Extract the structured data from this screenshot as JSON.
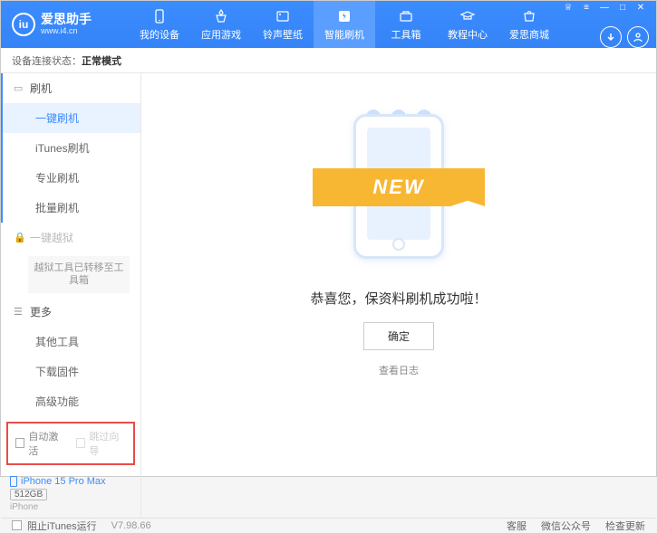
{
  "header": {
    "logo_title": "爱思助手",
    "logo_sub": "www.i4.cn",
    "nav": [
      {
        "label": "我的设备"
      },
      {
        "label": "应用游戏"
      },
      {
        "label": "铃声壁纸"
      },
      {
        "label": "智能刷机"
      },
      {
        "label": "工具箱"
      },
      {
        "label": "教程中心"
      },
      {
        "label": "爱思商城"
      }
    ]
  },
  "status": {
    "prefix": "设备连接状态：",
    "value": "正常模式"
  },
  "sidebar": {
    "group_flash": "刷机",
    "items_flash": [
      "一键刷机",
      "iTunes刷机",
      "专业刷机",
      "批量刷机"
    ],
    "group_jailbreak": "一键越狱",
    "jailbreak_note": "越狱工具已转移至工具箱",
    "group_more": "更多",
    "items_more": [
      "其他工具",
      "下载固件",
      "高级功能"
    ],
    "checkbox1": "自动激活",
    "checkbox2": "跳过向导",
    "device_name": "iPhone 15 Pro Max",
    "device_storage": "512GB",
    "device_type": "iPhone"
  },
  "main": {
    "ribbon": "NEW",
    "success": "恭喜您，保资料刷机成功啦！",
    "ok": "确定",
    "log_link": "查看日志"
  },
  "footer": {
    "block_itunes": "阻止iTunes运行",
    "version": "V7.98.66",
    "links": [
      "客服",
      "微信公众号",
      "检查更新"
    ]
  }
}
